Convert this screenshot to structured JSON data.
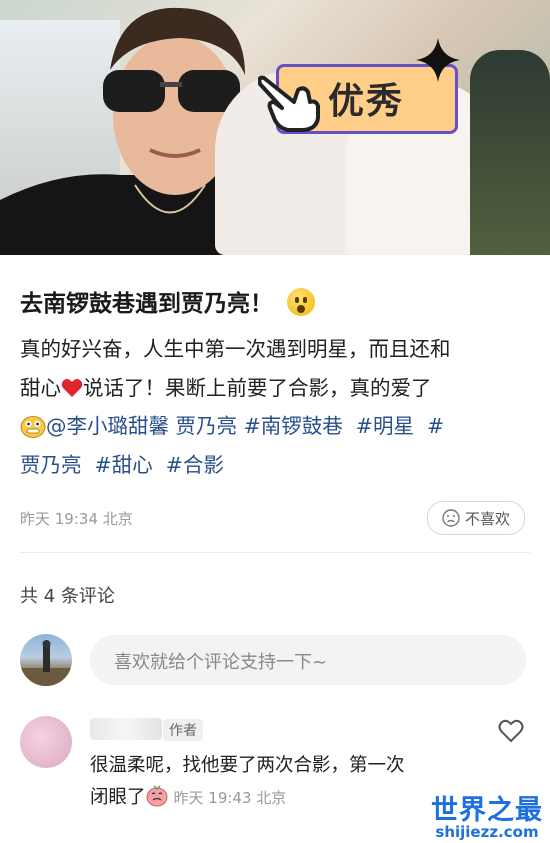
{
  "photo": {
    "badge_text": "优秀"
  },
  "post": {
    "title": "去南锣鼓巷遇到贾乃亮！",
    "line1": "真的好兴奋，人生中第一次遇到明星，而且还和",
    "line2_a": "甜心",
    "line2_b": "说话了！果断上前要了合影，真的爱了",
    "mention": "@李小璐甜馨",
    "mention_name": "贾乃亮",
    "tag1": "#南锣鼓巷",
    "tag2": "#明星",
    "tag3_a": "#",
    "tag3_b": "贾乃亮",
    "tag4": "#甜心",
    "tag5": "#合影",
    "meta": "昨天 19:34 北京",
    "dislike_label": "不喜欢"
  },
  "comments": {
    "count_label": "共 4 条评论",
    "input_placeholder": "喜欢就给个评论支持一下~",
    "items": [
      {
        "author_badge": "作者",
        "text_line1": "很温柔呢，找他要了两次合影，第一次",
        "text_line2": "闭眼了",
        "time": "昨天 19:43 北京"
      }
    ]
  },
  "watermark": {
    "cn": "世界之最",
    "en": "shijiezz.com"
  },
  "colors": {
    "link": "#2a4f8a",
    "badge_bg": "#ffcf8a",
    "badge_border": "#6a4ec9",
    "watermark": "#1e6fe0"
  }
}
